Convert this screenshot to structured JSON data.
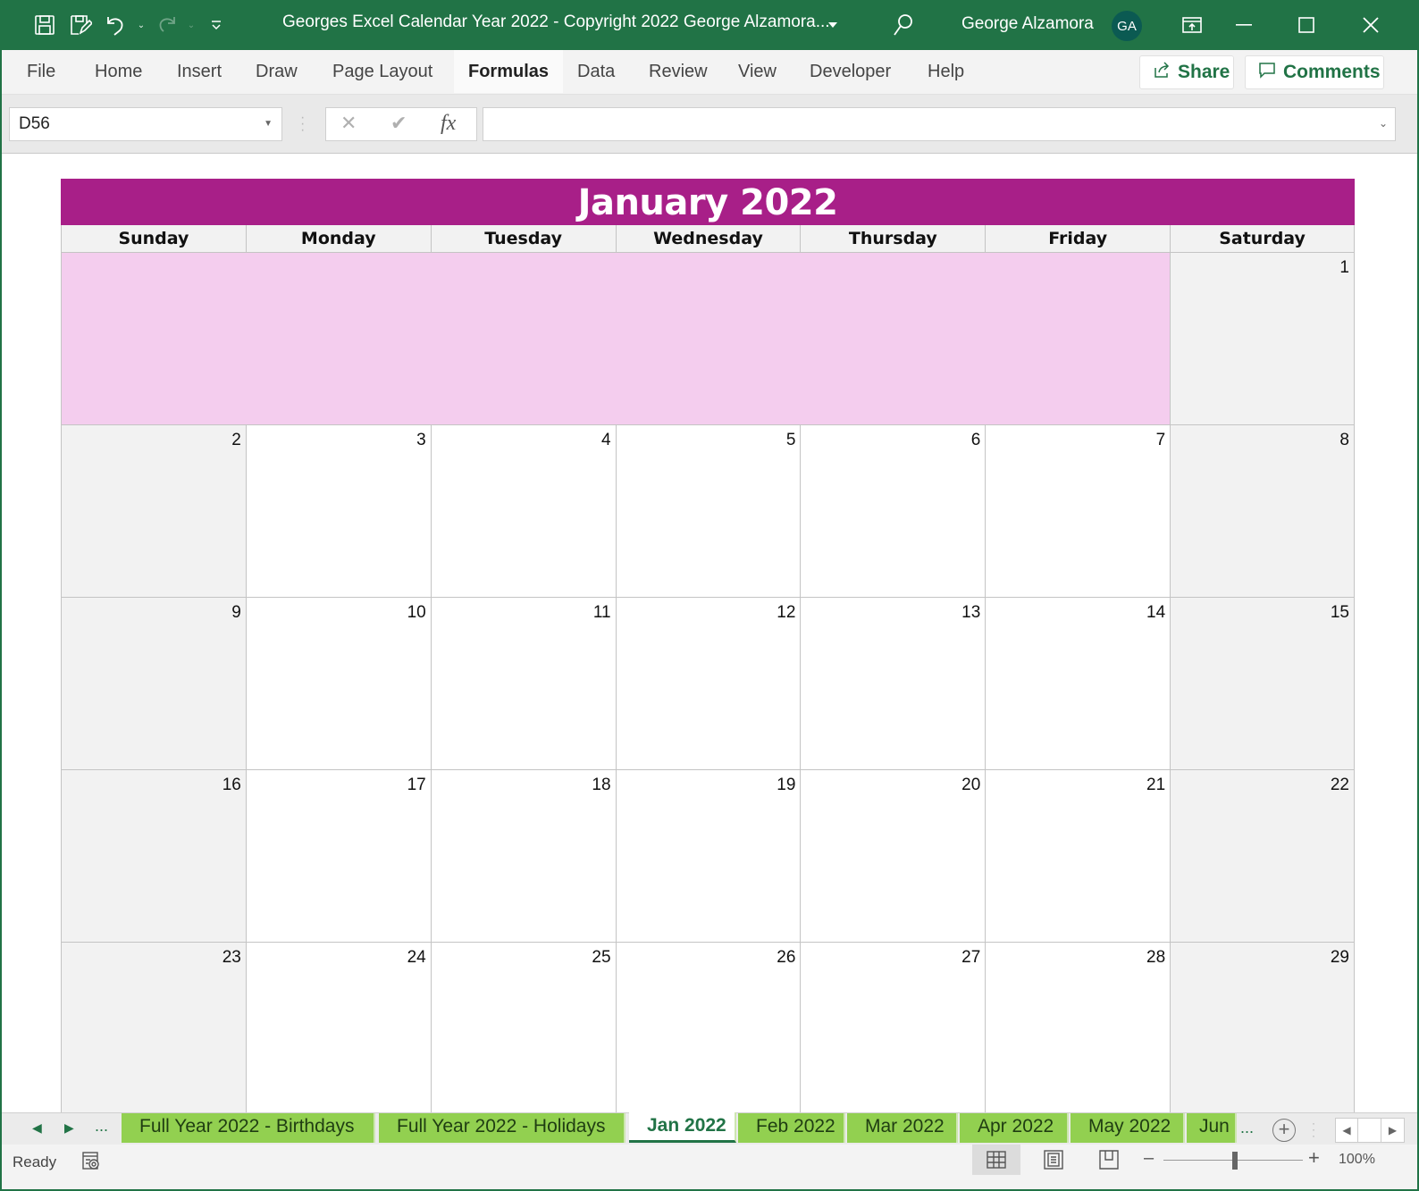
{
  "titlebar": {
    "document_title": "Georges Excel Calendar Year 2022 - Copyright 2022 George Alzamora...",
    "user_name": "George Alzamora",
    "avatar_initials": "GA"
  },
  "ribbon": {
    "tabs": [
      {
        "label": "File"
      },
      {
        "label": "Home"
      },
      {
        "label": "Insert"
      },
      {
        "label": "Draw"
      },
      {
        "label": "Page Layout"
      },
      {
        "label": "Formulas",
        "active": true
      },
      {
        "label": "Data"
      },
      {
        "label": "Review"
      },
      {
        "label": "View"
      },
      {
        "label": "Developer"
      },
      {
        "label": "Help"
      }
    ],
    "share_label": "Share",
    "comments_label": "Comments"
  },
  "formula_bar": {
    "name_box": "D56",
    "formula_value": "",
    "fx_label": "fx"
  },
  "calendar": {
    "title": "January 2022",
    "weekdays": [
      "Sunday",
      "Monday",
      "Tuesday",
      "Wednesday",
      "Thursday",
      "Friday",
      "Saturday"
    ],
    "weeks": [
      [
        null,
        null,
        null,
        null,
        null,
        null,
        "1"
      ],
      [
        "2",
        "3",
        "4",
        "5",
        "6",
        "7",
        "8"
      ],
      [
        "9",
        "10",
        "11",
        "12",
        "13",
        "14",
        "15"
      ],
      [
        "16",
        "17",
        "18",
        "19",
        "20",
        "21",
        "22"
      ],
      [
        "23",
        "24",
        "25",
        "26",
        "27",
        "28",
        "29"
      ]
    ],
    "colors": {
      "header": "#a81f88",
      "blank_days": "#f4cdee",
      "weekend": "#f2f2f2"
    }
  },
  "sheet_tabs": {
    "more_label": "...",
    "tabs": [
      {
        "label": "Full Year 2022 - Birthdays"
      },
      {
        "label": "Full Year 2022 - Holidays"
      },
      {
        "label": "Jan 2022",
        "active": true
      },
      {
        "label": "Feb 2022"
      },
      {
        "label": "Mar 2022"
      },
      {
        "label": "Apr 2022"
      },
      {
        "label": "May 2022"
      },
      {
        "label": "Jun"
      }
    ],
    "tab_color": "#92d050"
  },
  "status_bar": {
    "status": "Ready",
    "zoom_level": "100%",
    "zoom_percent": 100
  }
}
